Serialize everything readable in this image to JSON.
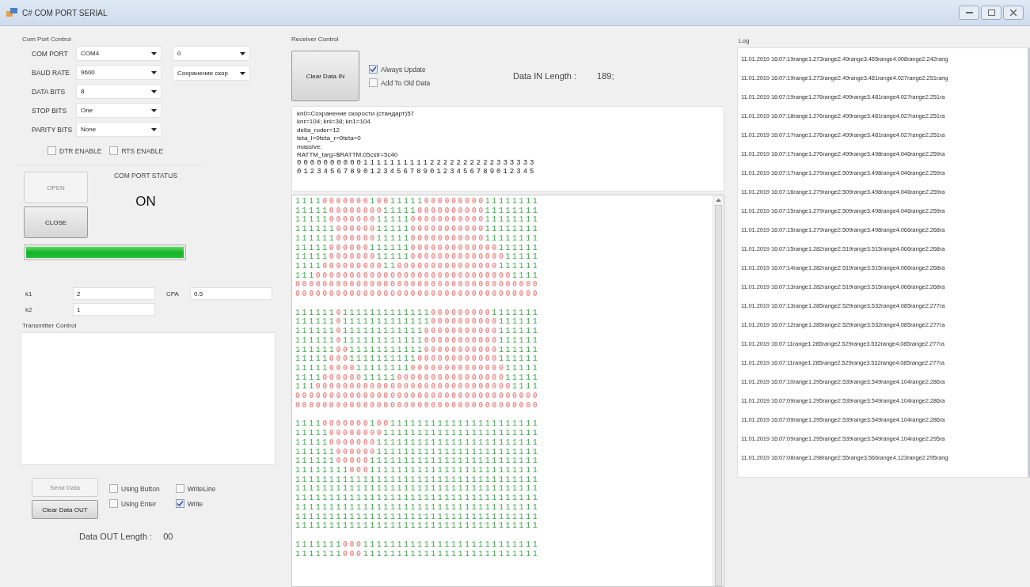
{
  "window": {
    "title": "C# COM PORT SERIAL"
  },
  "com_port_control": {
    "title": "Com Port Control",
    "settings": [
      {
        "label": "COM PORT",
        "value": "COM4"
      },
      {
        "label": "BAUD RATE",
        "value": "9600"
      },
      {
        "label": "DATA BITS",
        "value": "8"
      },
      {
        "label": "STOP BITS",
        "value": "One"
      },
      {
        "label": "PARITY BITS",
        "value": "None"
      }
    ],
    "extra_dropdowns": [
      {
        "value": "0"
      },
      {
        "value": "Сохранение скор"
      }
    ],
    "checkboxes": [
      {
        "label": "DTR ENABLE",
        "checked": false
      },
      {
        "label": "RTS ENABLE",
        "checked": false
      }
    ]
  },
  "status": {
    "buttons": [
      {
        "label": "OPEN",
        "disabled": true
      },
      {
        "label": "CLOSE",
        "disabled": false
      }
    ],
    "title": "COM PORT STATUS",
    "value": "ON",
    "progress": {
      "level": 1
    }
  },
  "params": [
    [
      {
        "label": "k1",
        "value": "2"
      },
      {
        "label": "CPA",
        "value": "0.5"
      }
    ],
    [
      {
        "label": "k2",
        "value": "1"
      }
    ]
  ],
  "transmitter": {
    "title": "Transmitter Control",
    "buttons": [
      {
        "label": "Send Data",
        "disabled": true
      },
      {
        "label": "Clear Data OUT",
        "disabled": false
      }
    ],
    "option_groups": [
      [
        {
          "label": "Using Button",
          "checked": false
        },
        {
          "label": "Using Enter",
          "checked": false
        }
      ],
      [
        {
          "label": "WriteLine",
          "checked": false
        },
        {
          "label": "Write",
          "checked": true
        }
      ]
    ],
    "length_label": "Data OUT Length :",
    "length_value": "00"
  },
  "receiver": {
    "title": "Receiver Control",
    "clear_button": {
      "label": "Clear Data IN",
      "disabled": false
    },
    "options": [
      {
        "label": "Always Update",
        "checked": true
      },
      {
        "label": "Add To Old Data",
        "checked": false
      }
    ],
    "length_label": "Data IN Length :",
    "length_value": "189;",
    "text_lines": [
      "kn0=Сохранение скорости (стандарт)57",
      "knr=104; knl=38; kn1=104",
      "delta_ruder=12",
      "teta_l=0teta_r=0teta=0",
      "massive:",
      "RATTM_targ=$RATTM,05cstr=5c40",
      "000000000011111111112222222222333333",
      "012345678901234567890123456789012345"
    ],
    "bit_blocks": [
      [
        "111100000001001111100000000011111111",
        "111110000000011111000000000011111111",
        "111110000000111110000000000011111111",
        "111111000000111110000000000011111111",
        "111111000000111110000000000011111111",
        "111110000001111110000000000000111111",
        "111110000000111110000000000000011111",
        "111100000000011000000000000000111111",
        "111000000000000000000000000000001111",
        "000000000000000000000000000000000000",
        "000000000000000000000000000000000000"
      ],
      [
        "111111011111111111110000000001111111",
        "111111011111111111110000000000111111",
        "111111011111111111100000000000111111",
        "111111011111111111100000000000111111",
        "111111001111111111100000000000111111",
        "111110001111111111000000000000111111",
        "111110000111111110000000000000011111",
        "111100000011111000000000000000011111",
        "111000000000000000000000000000001111",
        "000000000000000000000000000000000000",
        "000000000000000000000000000000000000"
      ],
      [
        "111100000001001111111111111111111111",
        "111110000000011111111111111111111111",
        "111110000000111111111111111111111111",
        "111111000000111111111111111111111111",
        "111111000001111111111111111111111111",
        "111111110001111111111111111111111111",
        "111111111111111111111111111111111111",
        "111111111111111111111111111111111111",
        "111111111111111111111111111111111111",
        "111111111111111111111111111111111111",
        "111111111111111111111111111111111111",
        "111111111111111111111111111111111111"
      ],
      [
        "111111100011111111111111111111111111",
        "111111100011111111111111111111111111"
      ]
    ]
  },
  "log": {
    "title": "Log",
    "entries": [
      "11.01.2019 16:07:19range1.273range2.49range3.465range4.008range2.242rang",
      "11.01.2019 16:07:19range1.273range2.49range3.481range4.027range2.251rang",
      "11.01.2019 16:07:19range1.276range2.499range3.481range4.027range2.251ra",
      "11.01.2019 16:07:18range1.276range2.499range3.481range4.027range2.251ra",
      "11.01.2019 16:07:17range1.276range2.499range3.481range4.027range2.251ra",
      "11.01.2019 16:07:17range1.276range2.499range3.498range4.046range2.259ra",
      "11.01.2019 16:07:17range1.279range2.509range3.498range4.046range2.259ra",
      "11.01.2019 16:07:16range1.279range2.509range3.498range4.046range2.259ra",
      "11.01.2019 16:07:15range1.279range2.509range3.498range4.046range2.259ra",
      "11.01.2019 16:07:15range1.279range2.509range3.498range4.066range2.268ra",
      "11.01.2019 16:07:15range1.282range2.519range3.515range4.066range2.268ra",
      "11.01.2019 16:07:14range1.282range2.519range3.515range4.066range2.268ra",
      "11.01.2019 16:07:13range1.282range2.519range3.515range4.066range2.268ra",
      "11.01.2019 16:07:13range1.285range2.529range3.532range4.085range2.277ra",
      "11.01.2019 16:07:12range1.285range2.529range3.532range4.085range2.277ra",
      "11.01.2019 16:07:11range1.285range2.529range3.532range4.085range2.277ra",
      "11.01.2019 16:07:11range1.285range2.529range3.532range4.085range2.277ra",
      "11.01.2019 16:07:10range1.295range2.539range3.549range4.104range2.286ra",
      "11.01.2019 16:07:09range1.295range2.539range3.549range4.104range2.286ra",
      "11.01.2019 16:07:09range1.295range2.539range3.549range4.104range2.286ra",
      "11.01.2019 16:07:09range1.295range2.539range3.549range4.104range2.295ra",
      "11.01.2019 16:07:08range1.298range2.55range3.566range4.123range2.295rang"
    ]
  }
}
